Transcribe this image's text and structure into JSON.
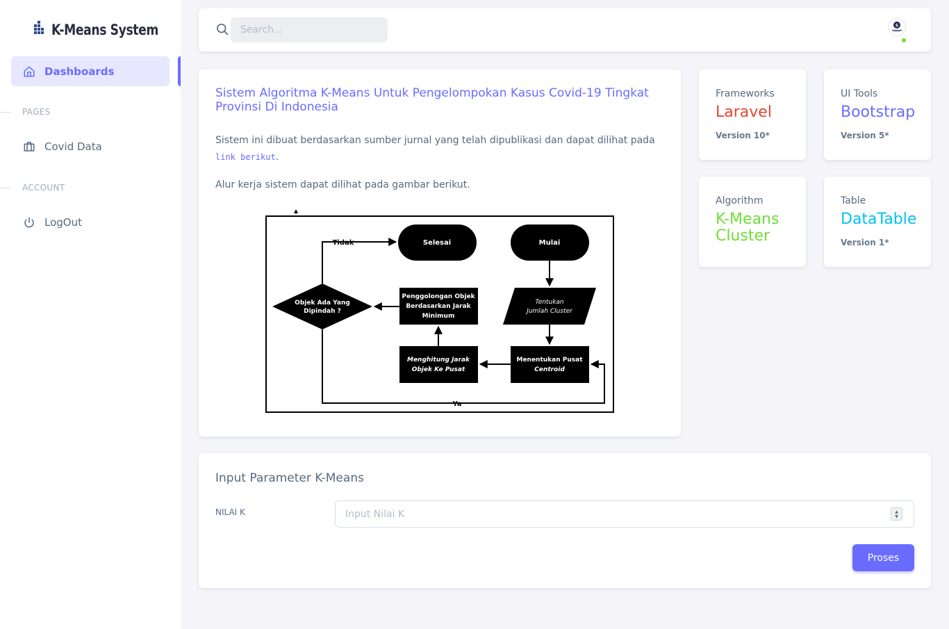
{
  "brand": {
    "name": "K-Means System",
    "icon": "bars-grid-icon"
  },
  "sidebar": {
    "dashboard_label": "Dashboards",
    "pages_header": "PAGES",
    "covid_label": "Covid Data",
    "account_header": "ACCOUNT",
    "logout_label": "LogOut"
  },
  "navbar": {
    "search_placeholder": "Search..."
  },
  "main": {
    "title": "Sistem Algoritma K-Means Untuk Pengelompokan Kasus Covid-19 Tingkat Provinsi Di Indonesia",
    "desc": "Sistem ini dibuat berdasarkan sumber jurnal yang telah dipublikasi dan dapat dilihat pada",
    "link_text": "link berikut",
    "desc_end": ".",
    "desc2": "Alur kerja sistem dapat dilihat pada gambar berikut."
  },
  "flowchart": {
    "tidak": "Tidak",
    "selesai": "Selesai",
    "mulai": "Mulai",
    "decision_line1": "Objek Ada Yang",
    "decision_line2": "Dipindah ?",
    "group_line1": "Penggolongan Objek",
    "group_line2": "Berdasarkan Jarak",
    "group_line3": "Minimum",
    "tentukan_line1": "Tentukan",
    "tentukan_line2": "Jumlah Cluster",
    "hitung_line1": "Menghitung Jarak",
    "hitung_line2": "Objek Ke Pusat",
    "pusat_line1": "Menentukan Pusat",
    "pusat_line2": "Centroid",
    "ya": "Ya"
  },
  "stats": [
    {
      "label": "Frameworks",
      "value": "Laravel",
      "version": "Version 10*",
      "color": "#e5462c"
    },
    {
      "label": "UI Tools",
      "value": "Bootstrap",
      "version": "Version 5*",
      "color": "#696cff"
    },
    {
      "label": "Algorithm",
      "value": "K-Means Cluster",
      "version": "",
      "color": "#71dd37"
    },
    {
      "label": "Table",
      "value": "DataTable",
      "version": "Version 1*",
      "color": "#03c3ec"
    }
  ],
  "input_section": {
    "title": "Input Parameter K-Means",
    "label": "NILAI K",
    "placeholder": "Input Nilai K",
    "button": "Proses"
  }
}
